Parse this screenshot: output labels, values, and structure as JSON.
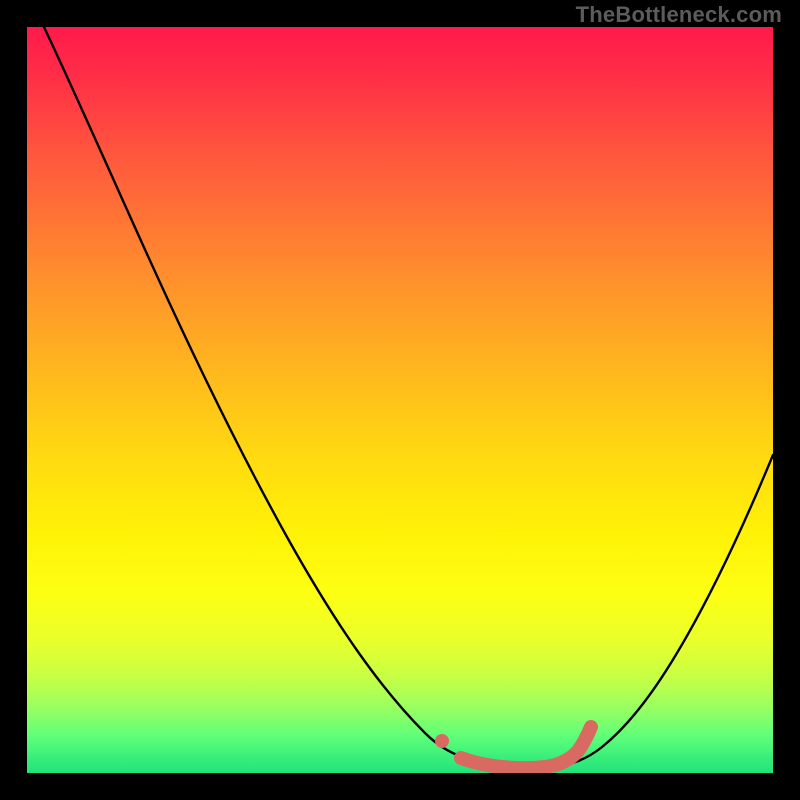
{
  "attribution": "TheBottleneck.com",
  "chart_data": {
    "type": "line",
    "title": "",
    "xlabel": "",
    "ylabel": "",
    "xlim": [
      0,
      100
    ],
    "ylim": [
      0,
      100
    ],
    "series": [
      {
        "name": "curve",
        "color": "#000000",
        "x": [
          0,
          6,
          12,
          18,
          24,
          30,
          36,
          42,
          48,
          54,
          58,
          62,
          66,
          70,
          74,
          80,
          86,
          92,
          100
        ],
        "y": [
          100,
          88,
          77,
          66,
          55,
          45,
          35,
          26,
          18,
          10,
          5,
          2,
          1,
          2,
          3,
          8,
          18,
          30,
          48
        ]
      },
      {
        "name": "highlight",
        "color": "#d86a61",
        "x": [
          55.5,
          57.0,
          60.0,
          63.0,
          66.0,
          68.5,
          70.0,
          71.0,
          72.0
        ],
        "y": [
          4.5,
          2.8,
          1.6,
          1.2,
          1.2,
          1.5,
          2.3,
          3.4,
          4.6
        ]
      }
    ],
    "gradient_stops": [
      {
        "offset": 0.0,
        "color": "#ff1a4b"
      },
      {
        "offset": 0.18,
        "color": "#ff5a3d"
      },
      {
        "offset": 0.46,
        "color": "#ffb71e"
      },
      {
        "offset": 0.68,
        "color": "#fff207"
      },
      {
        "offset": 0.87,
        "color": "#c8ff44"
      },
      {
        "offset": 1.0,
        "color": "#20e37a"
      }
    ]
  }
}
